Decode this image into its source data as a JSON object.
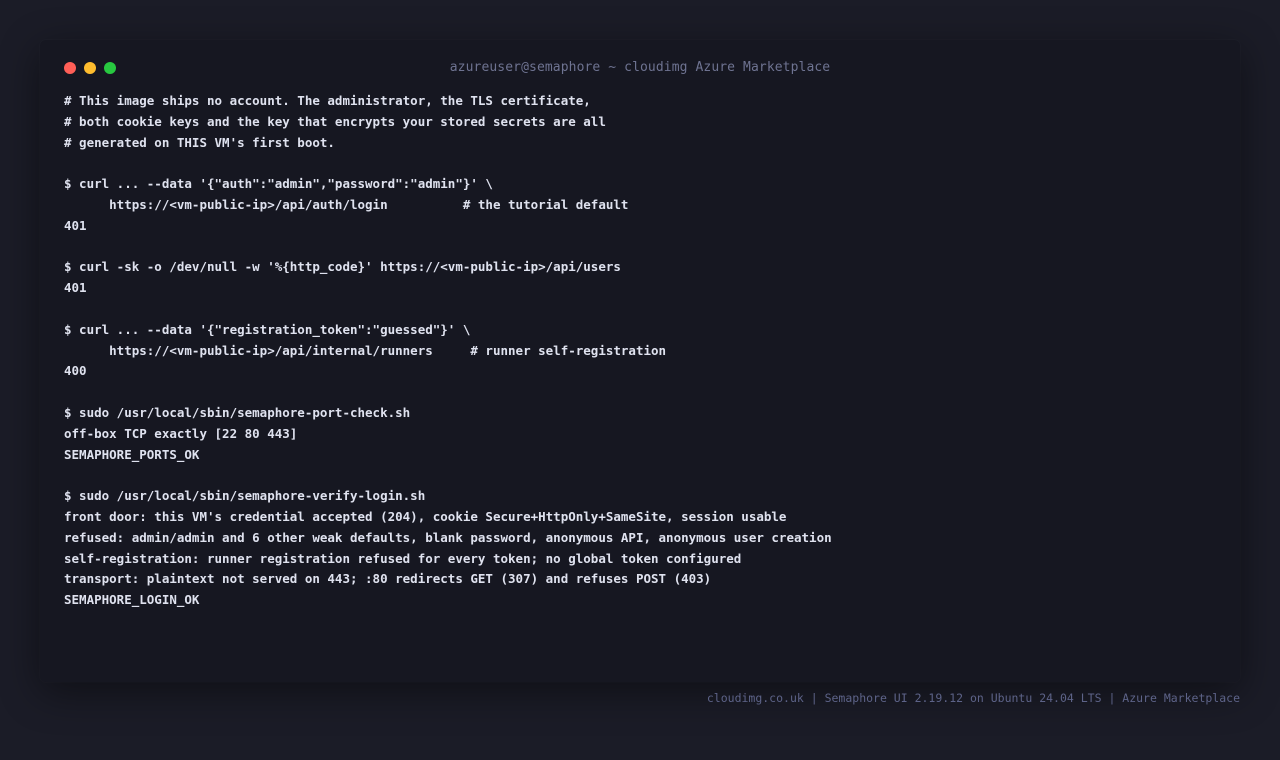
{
  "window": {
    "title": "azureuser@semaphore ~ cloudimg Azure Marketplace",
    "traffic_lights": [
      {
        "name": "close",
        "color": "#ff5f57"
      },
      {
        "name": "minimize",
        "color": "#febc2e"
      },
      {
        "name": "maximize",
        "color": "#28c840"
      }
    ]
  },
  "terminal": {
    "lines": [
      "# This image ships no account. The administrator, the TLS certificate,",
      "# both cookie keys and the key that encrypts your stored secrets are all",
      "# generated on THIS VM's first boot.",
      "",
      "$ curl ... --data '{\"auth\":\"admin\",\"password\":\"admin\"}' \\",
      "      https://<vm-public-ip>/api/auth/login          # the tutorial default",
      "401",
      "",
      "$ curl -sk -o /dev/null -w '%{http_code}' https://<vm-public-ip>/api/users",
      "401",
      "",
      "$ curl ... --data '{\"registration_token\":\"guessed\"}' \\",
      "      https://<vm-public-ip>/api/internal/runners     # runner self-registration",
      "400",
      "",
      "$ sudo /usr/local/sbin/semaphore-port-check.sh",
      "off-box TCP exactly [22 80 443]",
      "SEMAPHORE_PORTS_OK",
      "",
      "$ sudo /usr/local/sbin/semaphore-verify-login.sh",
      "front door: this VM's credential accepted (204), cookie Secure+HttpOnly+SameSite, session usable",
      "refused: admin/admin and 6 other weak defaults, blank password, anonymous API, anonymous user creation",
      "self-registration: runner registration refused for every token; no global token configured",
      "transport: plaintext not served on 443; :80 redirects GET (307) and refuses POST (403)",
      "SEMAPHORE_LOGIN_OK"
    ]
  },
  "footer": {
    "text": "cloudimg.co.uk | Semaphore UI 2.19.12 on Ubuntu 24.04 LTS | Azure Marketplace"
  }
}
